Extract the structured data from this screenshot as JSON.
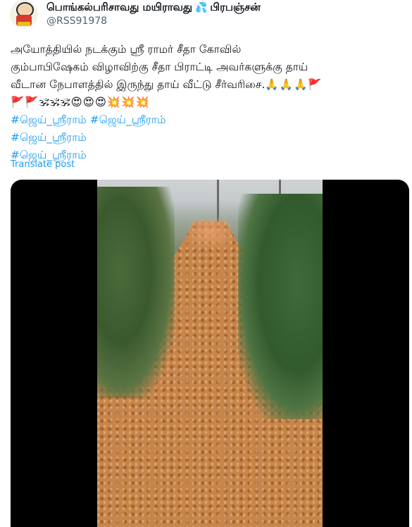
{
  "author": {
    "display_name": "பொங்கல்பரிசாவது மயிராவது",
    "display_name_suffix": "பிரபஞ்சன்",
    "droplet_emoji": "💦",
    "handle": "@RSS91978"
  },
  "tweet": {
    "line1": "அயோத்தியில் நடக்கும் ஸ்ரீ ராமர் சீதா கோவில்",
    "line2": "கும்பாபிஷேகம் விழாவிற்கு சீதா பிராட்டி அவர்களுக்கு தாய்",
    "line3": "வீடான நேபாளத்தில் இருந்து தாய் வீட்டு சீர்வரிசை.",
    "line3_emoji": "🙏🙏🙏🚩",
    "line4_emoji": "🚩🚩🕉🕉🕉😍😍😍💥💥💥",
    "hashtags": [
      "#ஜெய்_ஸ்ரீராம் #ஜெய்_ஸ்ரீராம்",
      "#ஜெய்_ஸ்ரீராம்",
      "#ஜெய்_ஸ்ரீராம்"
    ]
  },
  "translate_label": "Translate post",
  "colors": {
    "link": "#1d9bf0",
    "text": "#0f1419",
    "secondary": "#536471"
  }
}
